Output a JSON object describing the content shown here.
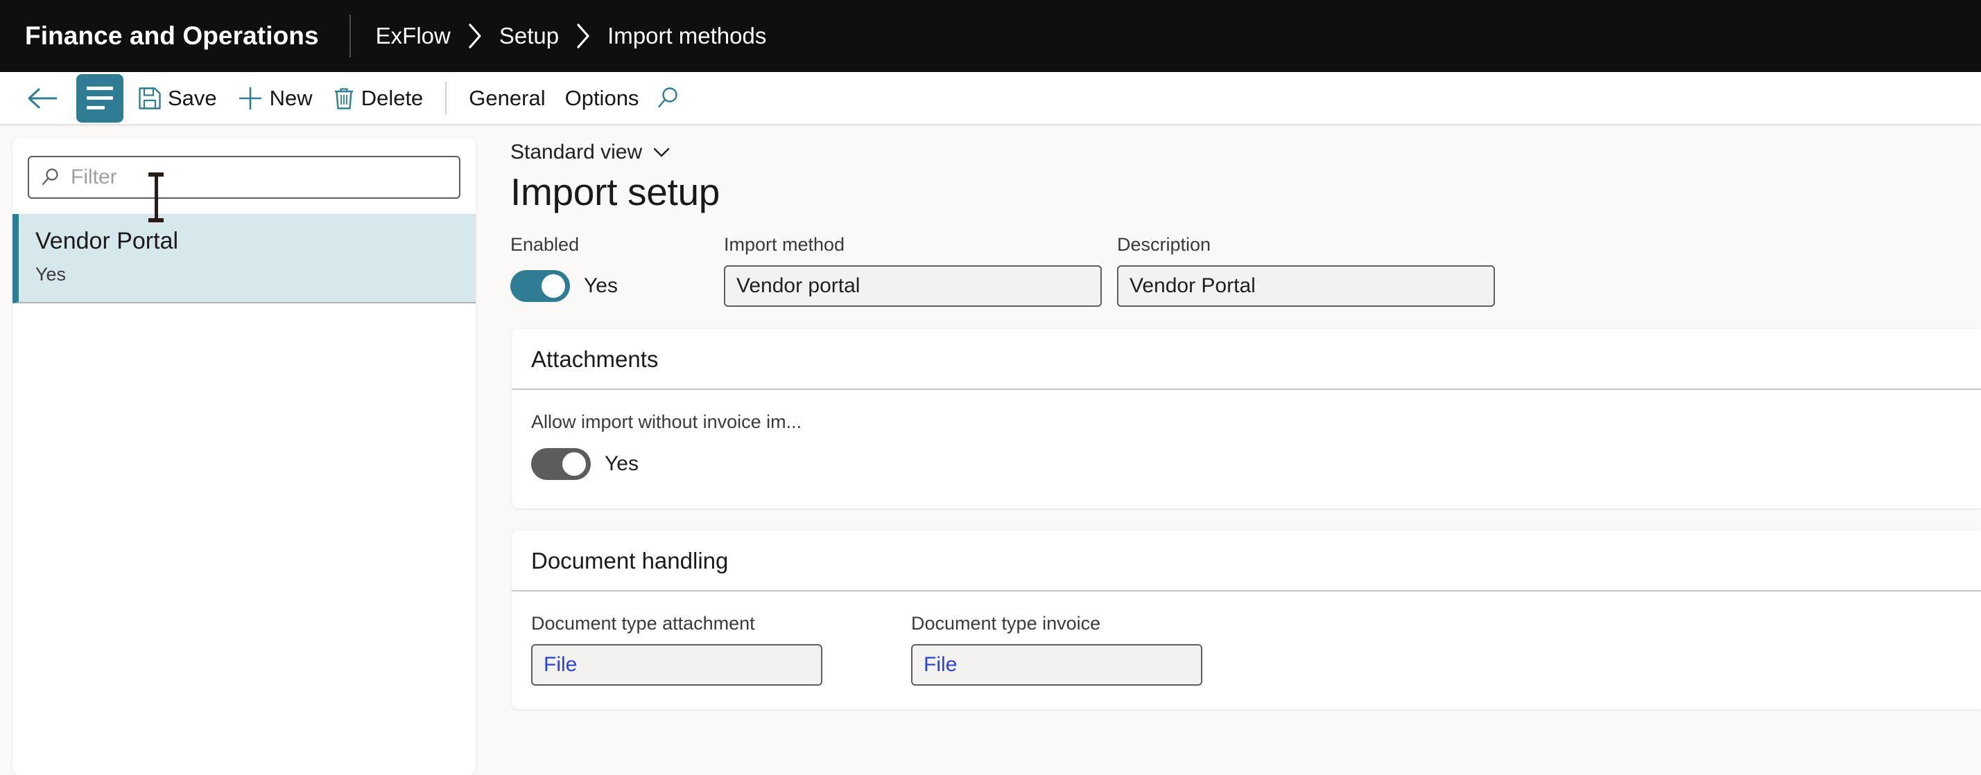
{
  "topbar": {
    "app_title": "Finance and Operations",
    "breadcrumb": [
      "ExFlow",
      "Setup",
      "Import methods"
    ]
  },
  "toolbar": {
    "back_icon": "arrow-left-icon",
    "menu_icon": "hamburger-icon",
    "save_label": "Save",
    "save_icon": "save-disk-icon",
    "new_label": "New",
    "new_icon": "plus-icon",
    "delete_label": "Delete",
    "delete_icon": "trash-icon",
    "general_label": "General",
    "options_label": "Options",
    "search_icon": "search-icon"
  },
  "sidebar": {
    "filter": {
      "icon": "search-icon",
      "value": "",
      "placeholder": "Filter"
    },
    "items": [
      {
        "title": "Vendor Portal",
        "subtitle": "Yes",
        "selected": true
      }
    ]
  },
  "main": {
    "view_selector": {
      "label": "Standard view",
      "chevron_icon": "chevron-down-icon"
    },
    "page_title": "Import setup",
    "header_fields": {
      "enabled": {
        "label": "Enabled",
        "state": "on",
        "value_text": "Yes"
      },
      "import_method": {
        "label": "Import method",
        "value": "Vendor portal"
      },
      "description": {
        "label": "Description",
        "value": "Vendor Portal"
      }
    },
    "sections": [
      {
        "title": "Attachments",
        "toggle": {
          "label": "Allow import without invoice im...",
          "state": "off",
          "value_text": "Yes"
        }
      },
      {
        "title": "Document handling",
        "fields": [
          {
            "label": "Document type attachment",
            "value": "File"
          },
          {
            "label": "Document type invoice",
            "value": "File"
          }
        ]
      }
    ]
  },
  "colors": {
    "topbar_bg": "#0f0f0f",
    "accent_teal": "#2f7d95",
    "selection_bg": "#d7e8ec",
    "content_bg": "#faf9f8",
    "link_blue": "#2b41d8"
  }
}
